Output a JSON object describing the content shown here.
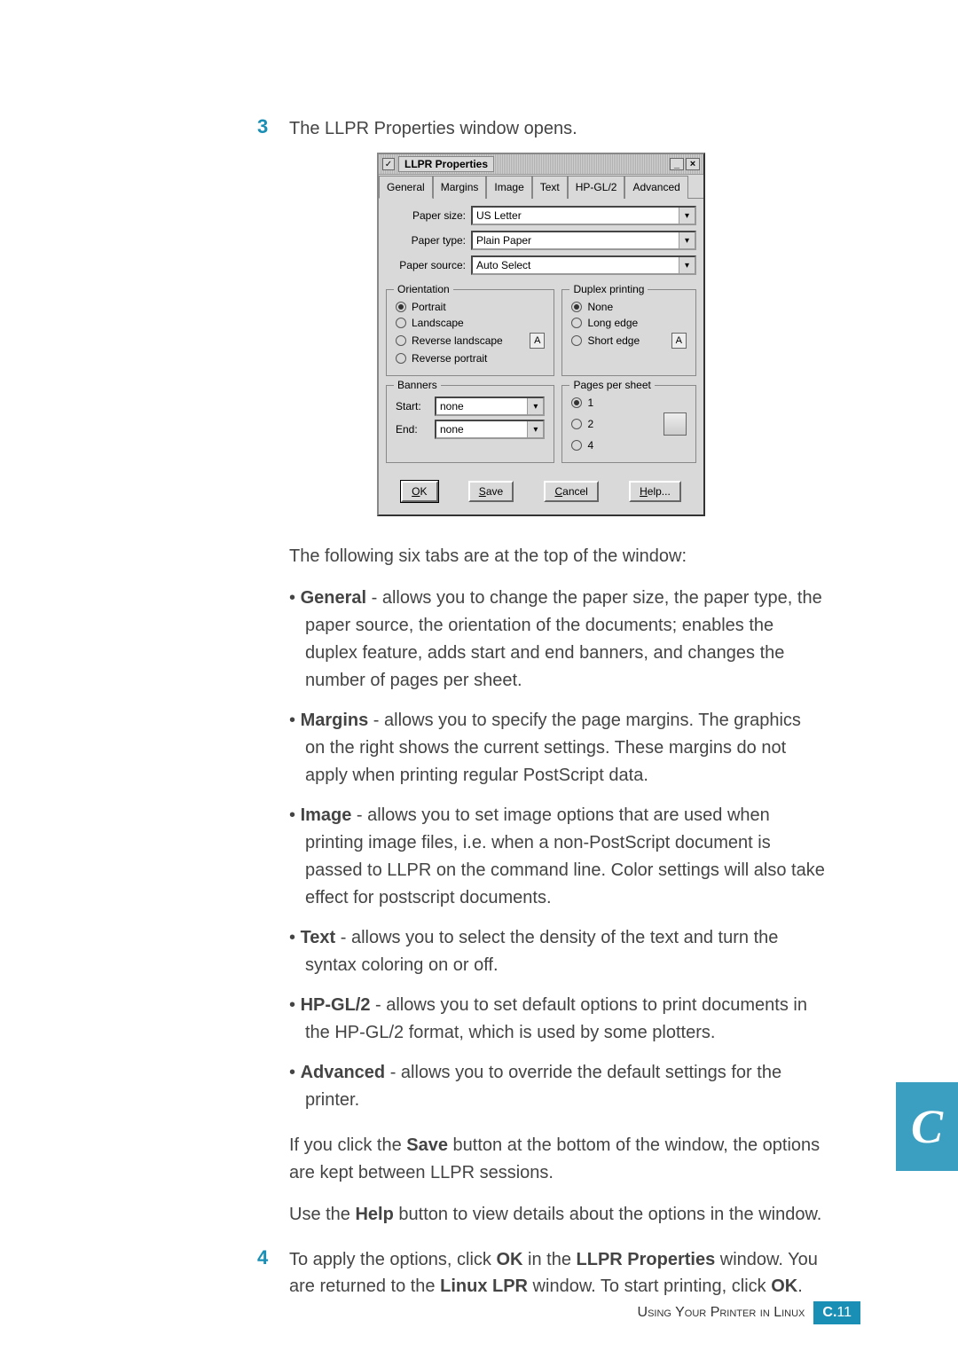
{
  "step3": {
    "num": "3",
    "text": "The LLPR Properties window opens."
  },
  "dialog": {
    "title": "LLPR Properties",
    "minimize": "_",
    "close": "×",
    "tabs": [
      "General",
      "Margins",
      "Image",
      "Text",
      "HP-GL/2",
      "Advanced"
    ],
    "paper_size_label": "Paper size:",
    "paper_size_value": "US Letter",
    "paper_type_label": "Paper type:",
    "paper_type_value": "Plain Paper",
    "paper_source_label": "Paper source:",
    "paper_source_value": "Auto Select",
    "orientation": {
      "legend": "Orientation",
      "portrait": "Portrait",
      "landscape": "Landscape",
      "rev_landscape": "Reverse landscape",
      "rev_portrait": "Reverse portrait",
      "icon": "A"
    },
    "duplex": {
      "legend": "Duplex printing",
      "none": "None",
      "long": "Long edge",
      "short": "Short edge",
      "icon": "A"
    },
    "banners": {
      "legend": "Banners",
      "start_label": "Start:",
      "start_value": "none",
      "end_label": "End:",
      "end_value": "none"
    },
    "pps": {
      "legend": "Pages per sheet",
      "opt1": "1",
      "opt2": "2",
      "opt4": "4"
    },
    "ok": "OK",
    "save": "Save",
    "cancel": "Cancel",
    "help": "Help..."
  },
  "tabs_intro": "The following six tabs are at the top of the window:",
  "bullets": {
    "general_b": "General",
    "general_t": " - allows you to change the paper size, the paper type, the paper source, the orientation of the documents; enables the duplex feature, adds start and end banners, and changes the number of pages per sheet.",
    "margins_b": "Margins",
    "margins_t": " - allows you to specify the page margins. The graphics on the right shows the current settings. These margins do not apply when printing regular PostScript data.",
    "image_b": "Image",
    "image_t": " - allows you to set image options that are used when printing image files, i.e. when a non-PostScript document is passed to LLPR on the command line. Color settings will also take effect for postscript documents.",
    "text_b": "Text",
    "text_t": " - allows you to select the density of the text and turn the syntax coloring on or off.",
    "hpgl2_b": "HP-GL/2",
    "hpgl2_t": " - allows you to set default options to print documents in the HP-GL/2 format, which is used by some plotters.",
    "advanced_b": "Advanced",
    "advanced_t": " - allows you to override the default settings for the printer."
  },
  "save_para_1": "If you click the ",
  "save_para_b": "Save",
  "save_para_2": " button at the bottom of the window, the options are kept between LLPR sessions.",
  "help_para_1": "Use the ",
  "help_para_b": "Help",
  "help_para_2": " button to view details about the options in the window.",
  "step4": {
    "num": "4",
    "p1": "To apply the options, click ",
    "p2": "OK",
    "p3": " in the ",
    "p4": "LLPR Properties",
    "p5": " window. You are returned to the ",
    "p6": "Linux LPR",
    "p7": " window. To start printing, click ",
    "p8": "OK",
    "p9": "."
  },
  "side_letter": "C",
  "footer": {
    "text_caps": "Using Your Printer in Linux",
    "page_prefix": "C.",
    "page_num": "11"
  }
}
